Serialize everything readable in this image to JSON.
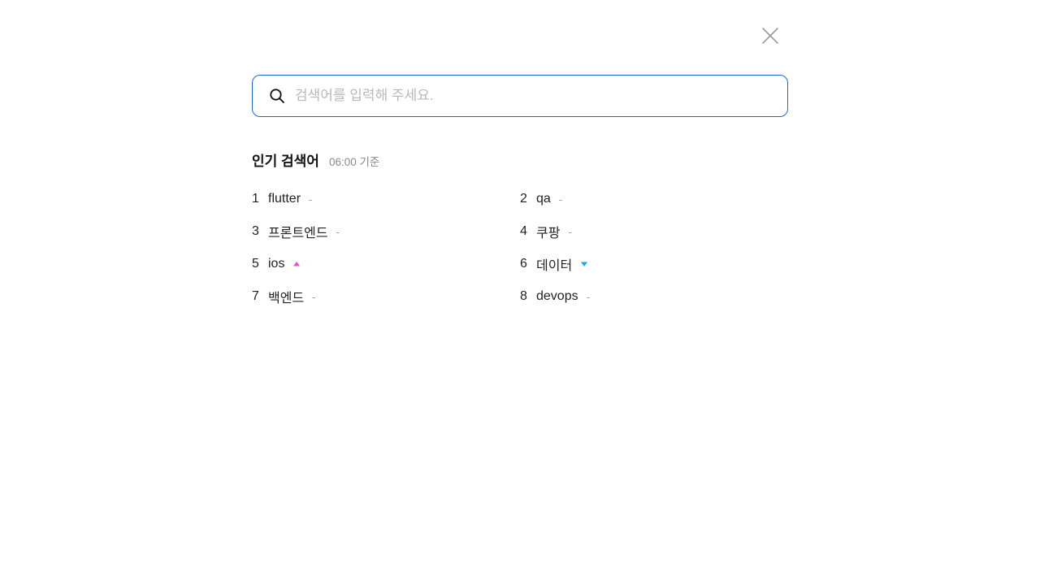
{
  "search": {
    "placeholder": "검색어를 입력해 주세요."
  },
  "popular": {
    "title": "인기 검색어",
    "time": "06:00 기준",
    "keywords": [
      {
        "rank": "1",
        "text": "flutter",
        "trend": "same",
        "trend_label": "-"
      },
      {
        "rank": "2",
        "text": "qa",
        "trend": "same",
        "trend_label": "-"
      },
      {
        "rank": "3",
        "text": "프론트엔드",
        "trend": "same",
        "trend_label": "-"
      },
      {
        "rank": "4",
        "text": "쿠팡",
        "trend": "same",
        "trend_label": "-"
      },
      {
        "rank": "5",
        "text": "ios",
        "trend": "up",
        "trend_label": ""
      },
      {
        "rank": "6",
        "text": "데이터",
        "trend": "down",
        "trend_label": ""
      },
      {
        "rank": "7",
        "text": "백엔드",
        "trend": "same",
        "trend_label": "-"
      },
      {
        "rank": "8",
        "text": "devops",
        "trend": "same",
        "trend_label": "-"
      }
    ]
  },
  "colors": {
    "accent": "#1a6ad8",
    "trend_up": "#e84fc8",
    "trend_down": "#1ea7e6"
  },
  "icons": {
    "close": "close-icon",
    "search": "search-icon"
  }
}
